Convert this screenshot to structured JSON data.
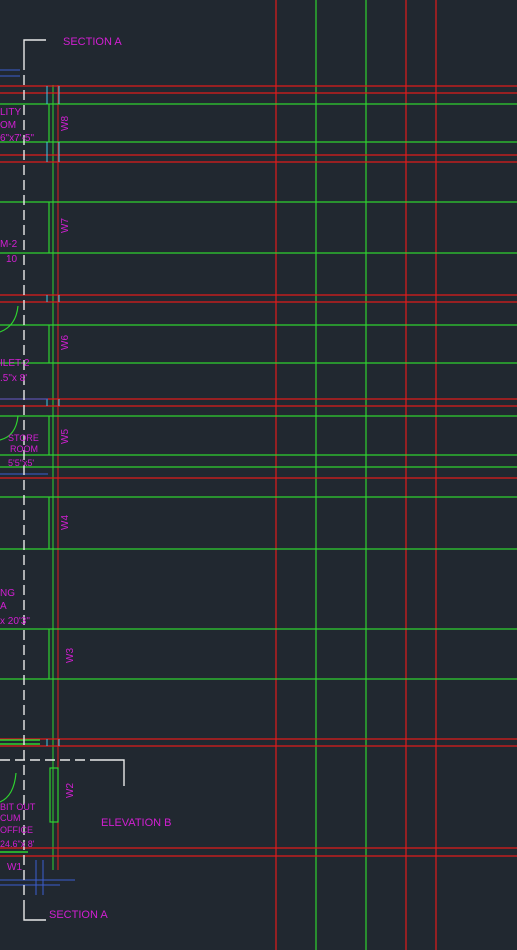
{
  "colors": {
    "background": "#212830",
    "red": "#e01b1b",
    "green": "#2fd22f",
    "magenta": "#d21fd2",
    "white": "#e8e8e8",
    "cyan": "#3fc8e6",
    "blue": "#3a5ecf"
  },
  "labels": {
    "section_top": "SECTION A",
    "section_bottom": "SECTION A",
    "elevation": "ELEVATION B"
  },
  "windows": [
    "W8",
    "W7",
    "W6",
    "W5",
    "W4",
    "W3",
    "W2",
    "W1"
  ],
  "rooms": {
    "r1": [
      "LITY",
      "OM",
      "6\"x7'-5\""
    ],
    "r2": [
      "M-2",
      "10"
    ],
    "r3": [
      "ILET-2",
      ".5\"x 8'"
    ],
    "r4": [
      "STORE",
      "ROOM",
      "5'5\"x5'"
    ],
    "r5": [
      "NG",
      "A",
      "x 20'3\""
    ],
    "r6": [
      "BIT OUT",
      "CUM",
      "OFFICE",
      "24.6\"x 8'"
    ]
  }
}
